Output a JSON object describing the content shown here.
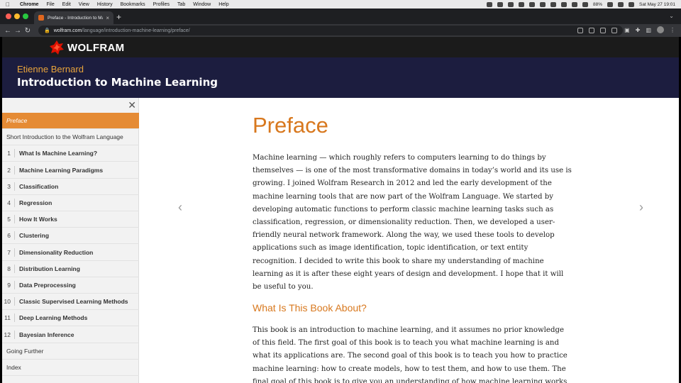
{
  "menubar": {
    "app": "Chrome",
    "items": [
      "File",
      "Edit",
      "View",
      "History",
      "Bookmarks",
      "Profiles",
      "Tab",
      "Window",
      "Help"
    ],
    "battery": "88%",
    "clock": "Sat May 27  19:01"
  },
  "browser": {
    "tab_title": "Preface - Introduction to Machi",
    "url_host": "wolfram.com",
    "url_path": "/language/introduction-machine-learning/preface/"
  },
  "site": {
    "logo_text": "WOLFRAM"
  },
  "book": {
    "author": "Etienne Bernard",
    "title": "Introduction to Machine Learning"
  },
  "sidebar": {
    "items": [
      {
        "num": "",
        "label": "Preface",
        "active": true
      },
      {
        "num": "",
        "label": "Short Introduction to the Wolfram Language"
      },
      {
        "num": "1",
        "label": "What Is Machine Learning?"
      },
      {
        "num": "2",
        "label": "Machine Learning Paradigms"
      },
      {
        "num": "3",
        "label": "Classification"
      },
      {
        "num": "4",
        "label": "Regression"
      },
      {
        "num": "5",
        "label": "How It Works"
      },
      {
        "num": "6",
        "label": "Clustering"
      },
      {
        "num": "7",
        "label": "Dimensionality Reduction"
      },
      {
        "num": "8",
        "label": "Distribution Learning"
      },
      {
        "num": "9",
        "label": "Data Preprocessing"
      },
      {
        "num": "10",
        "label": "Classic Supervised Learning Methods"
      },
      {
        "num": "11",
        "label": "Deep Learning Methods"
      },
      {
        "num": "12",
        "label": "Bayesian Inference"
      },
      {
        "num": "",
        "label": "Going Further"
      },
      {
        "num": "",
        "label": "Index"
      }
    ]
  },
  "content": {
    "heading": "Preface",
    "para1": "Machine learning — which roughly refers to computers learning to do things by themselves — is one of the most transformative domains in today’s world and its use is growing. I joined Wolfram Research in 2012 and led the early development of the machine learning tools that are now part of the Wolfram Language. We started by developing automatic functions to perform classic machine learning tasks such as classification, regression, or dimensionality reduction. Then, we developed a user-friendly neural network framework. Along the way, we used these tools to develop applications such as image identification, topic identification, or text entity recognition. I decided to write this book to share my understanding of machine learning as it is after these eight years of design and development. I hope that it will be useful to you.",
    "subheading": "What Is This Book About?",
    "para2": "This book is an introduction to machine learning, and it assumes no prior knowledge of this field. The first goal of this book is to teach you what machine learning is and what its applications are. The second goal of this book is to teach you how to practice machine learning: how to create models, how to test them, and how to use them. The final goal of this book is to give you an understanding of how machine learning works and the"
  },
  "icons": {
    "prev": "chevron-left-icon",
    "next": "chevron-right-icon",
    "close": "close-icon"
  },
  "colors": {
    "accent": "#e58b35",
    "header_bg": "#1c1d3f",
    "author": "#e8a43b"
  }
}
